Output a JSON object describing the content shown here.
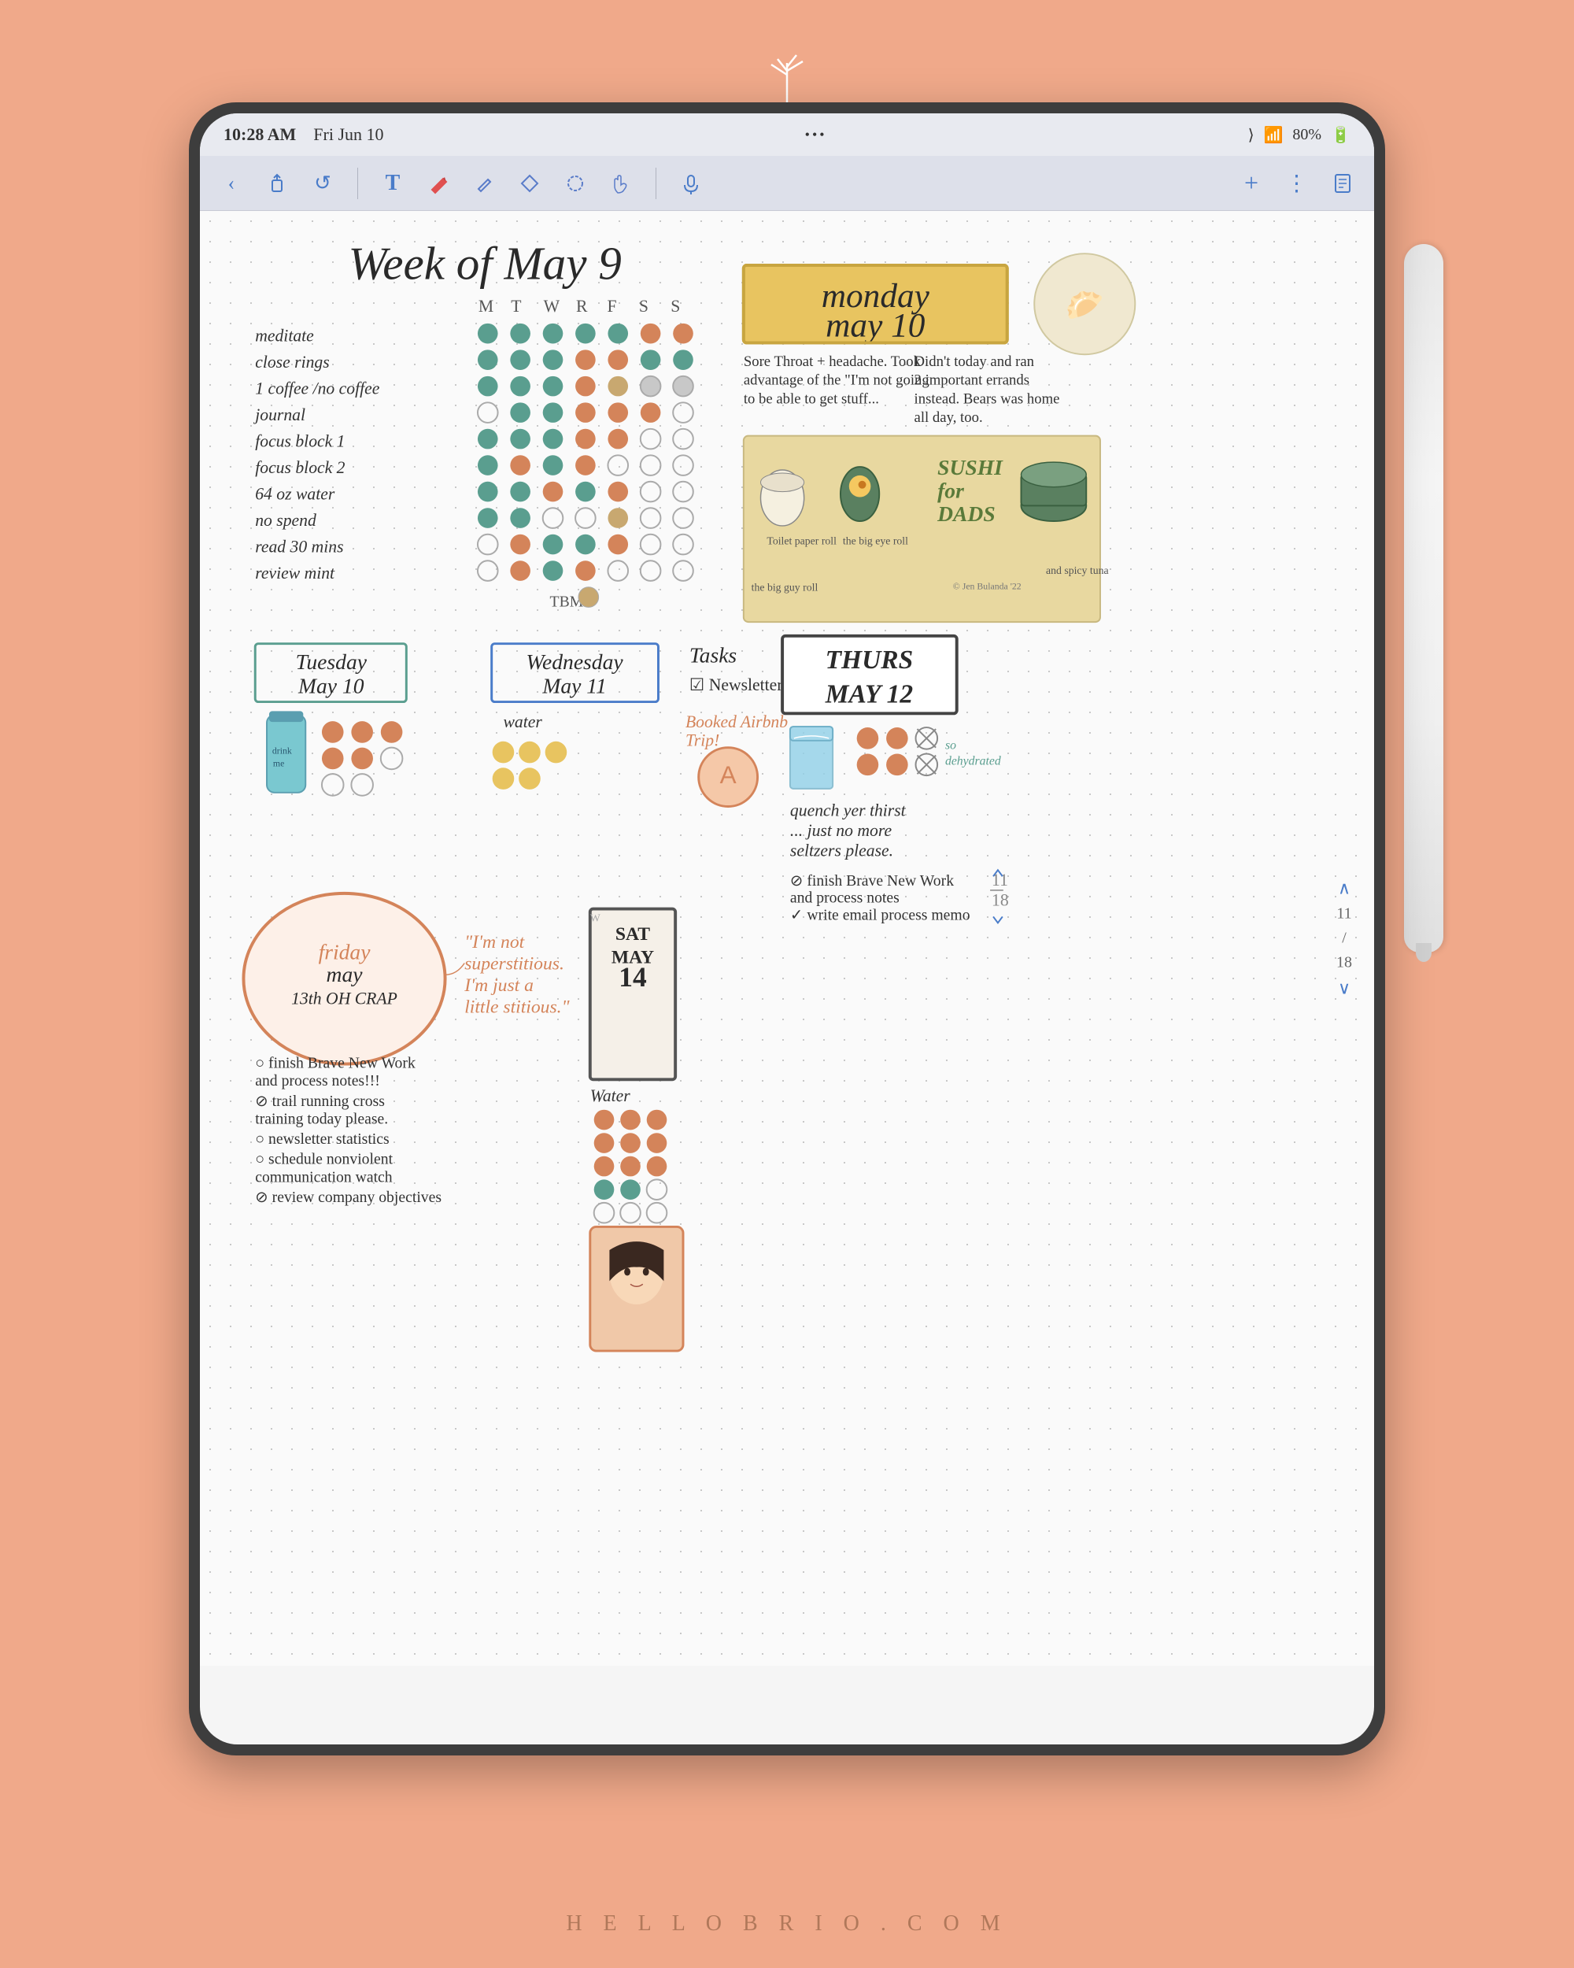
{
  "page": {
    "background_color": "#f0a98a",
    "footer_text": "H E L L O B R I O . C O M"
  },
  "status_bar": {
    "time": "10:28 AM",
    "date": "Fri Jun 10",
    "dots": "•••",
    "battery": "80%",
    "wifi": "wifi",
    "location": "location"
  },
  "toolbar": {
    "back_label": "‹",
    "share_label": "⬆",
    "undo_label": "↺",
    "text_label": "T",
    "pen_label": "✏",
    "pencil_label": "✎",
    "eraser_label": "⬡",
    "lasso_label": "⊙",
    "touch_label": "✋",
    "mic_label": "🎙",
    "add_label": "+",
    "more_label": "⋮",
    "doc_label": "📄"
  },
  "notebook": {
    "week_header": "Week of May 9",
    "day_headers": [
      "M",
      "T",
      "W",
      "R",
      "F",
      "S",
      "S"
    ],
    "habits": [
      {
        "name": "meditate",
        "circles": [
          "teal",
          "teal",
          "teal",
          "teal",
          "teal",
          "orange",
          "orange"
        ]
      },
      {
        "name": "close rings",
        "circles": [
          "teal",
          "teal",
          "teal",
          "orange",
          "orange",
          "teal",
          "teal"
        ]
      },
      {
        "name": "1 coffee / no coffee",
        "circles": [
          "teal",
          "teal",
          "orange",
          "orange",
          "tan",
          "empty",
          "empty"
        ]
      },
      {
        "name": "journal",
        "circles": [
          "empty",
          "teal",
          "teal",
          "orange",
          "orange",
          "orange",
          "empty"
        ]
      },
      {
        "name": "focus block 1",
        "circles": [
          "teal",
          "teal",
          "teal",
          "orange",
          "orange",
          "empty",
          "empty"
        ]
      },
      {
        "name": "focus block 2",
        "circles": [
          "teal",
          "orange",
          "teal",
          "orange",
          "empty",
          "empty",
          "empty"
        ]
      },
      {
        "name": "64 oz water",
        "circles": [
          "teal",
          "teal",
          "orange",
          "teal",
          "orange",
          "empty",
          "empty"
        ]
      },
      {
        "name": "no spend",
        "circles": [
          "teal",
          "teal",
          "empty",
          "empty",
          "tan",
          "empty",
          "empty"
        ]
      },
      {
        "name": "read 30 mins",
        "circles": [
          "empty",
          "orange",
          "teal",
          "teal",
          "orange",
          "empty",
          "empty"
        ]
      },
      {
        "name": "review mint",
        "circles": [
          "empty",
          "orange",
          "teal",
          "orange",
          "empty",
          "empty",
          "empty"
        ]
      }
    ],
    "monday": {
      "title": "monday\nmay 10",
      "note1": "Sore Throat + headache. Took advantage of the \"I'm not going to be able to get stuff...",
      "note2": "Didn't today and ran 2 important errands instead. Bears was home all day, too.",
      "sushi_title": "SUSHI\nfor\nDADS",
      "sushi_labels": [
        "Toilet paper roll",
        "the big eye roll",
        "the big guy roll",
        "and spicy tuna"
      ],
      "copyright": "© Jen Bulanda '22"
    },
    "tuesday": {
      "title": "Tuesday\nMay 10",
      "water_tracker": true
    },
    "wednesday": {
      "title": "Wednesday\nMay 11",
      "water_label": "water",
      "circles": [
        "yellow",
        "yellow",
        "yellow",
        "yellow",
        "yellow"
      ]
    },
    "tasks": {
      "title": "Tasks",
      "items": [
        "☑ Newsletter"
      ]
    },
    "airbnb": {
      "label": "Booked Airbnb\nTrip!",
      "icon": "A"
    },
    "thursday": {
      "title": "THURS\nMAY 12",
      "water_glass": true,
      "circles_xd": [
        [
          "orange",
          "orange",
          "x"
        ],
        [
          "orange",
          "orange",
          "x"
        ]
      ],
      "note": "so dehydrated",
      "body_text": "quench yer thirst\n... just no more\nseltzers please.",
      "tasks": [
        "⊘ finish Brave New Work\n  and process notes",
        "✓ write email process memo"
      ]
    },
    "friday": {
      "title": "friday\nmay\n13th OH CRAP",
      "quote": "\"I'm not\nsuperstitious.\nI'm just a\nlittle stitious.\"",
      "tasks": [
        "○ finish Brave New Work\n  and process notes!!!",
        "⊘ trail running cross\n  training today please.",
        "○ newsletter statistics",
        "○ schedule nonviolent\n  communication watch",
        "⊘ review company objectives"
      ]
    },
    "saturday": {
      "title": "SAT\nMAY\n14",
      "water_label": "Water",
      "water_circles": [
        [
          "orange",
          "orange"
        ],
        [
          "orange",
          "orange"
        ],
        [
          "orange",
          "orange"
        ]
      ],
      "water_green_circles": [
        [
          "teal",
          "teal"
        ],
        [
          "teal",
          "empty"
        ],
        [
          "empty",
          "empty"
        ]
      ],
      "portrait": true
    },
    "page_numbers": {
      "top": "11",
      "bottom": "18",
      "divider": "/"
    }
  },
  "bottom_bar": {
    "star_icon": "☆",
    "zoom_icon": "⊕"
  }
}
